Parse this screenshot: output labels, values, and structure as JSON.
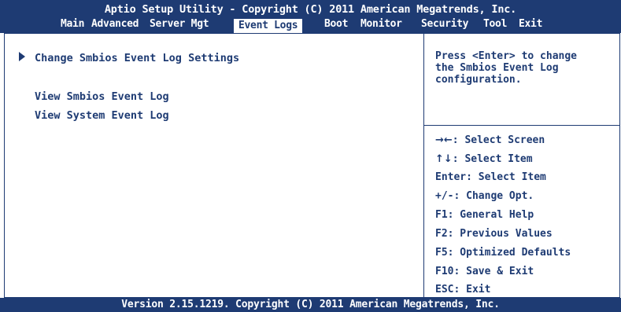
{
  "header": {
    "title": "Aptio Setup Utility - Copyright (C) 2011 American Megatrends, Inc.",
    "menu": [
      {
        "label": "Main",
        "active": false
      },
      {
        "label": "Advanced",
        "active": false
      },
      {
        "label": "Server Mgt",
        "active": false
      },
      {
        "label": "Event Logs",
        "active": true
      },
      {
        "label": "Boot",
        "active": false
      },
      {
        "label": "Monitor",
        "active": false
      },
      {
        "label": "Security",
        "active": false
      },
      {
        "label": "Tool",
        "active": false
      },
      {
        "label": "Exit",
        "active": false
      }
    ]
  },
  "left_panel": {
    "items": [
      {
        "label": "Change Smbios Event Log Settings",
        "submenu": true
      },
      {
        "label": "View Smbios Event Log",
        "submenu": false
      },
      {
        "label": "View System Event Log",
        "submenu": false
      }
    ]
  },
  "right_panel": {
    "help_text": "Press <Enter> to change\nthe Smbios Event Log\nconfiguration.",
    "keys": [
      {
        "key": "→←",
        "desc": ": Select Screen"
      },
      {
        "key": "↑↓",
        "desc": ": Select Item"
      },
      {
        "key": "Enter",
        "desc": ": Select Item"
      },
      {
        "key": "+/-",
        "desc": ": Change Opt."
      },
      {
        "key": "F1",
        "desc": ": General Help"
      },
      {
        "key": "F2",
        "desc": ": Previous Values"
      },
      {
        "key": "F5",
        "desc": ": Optimized Defaults"
      },
      {
        "key": "F10",
        "desc": ": Save & Exit"
      },
      {
        "key": "ESC",
        "desc": ": Exit"
      }
    ]
  },
  "footer": {
    "text": "Version 2.15.1219. Copyright (C) 2011 American Megatrends, Inc."
  },
  "colors": {
    "bar": "#1e3b73",
    "background": "#ffffff",
    "text": "#1e3b73"
  }
}
